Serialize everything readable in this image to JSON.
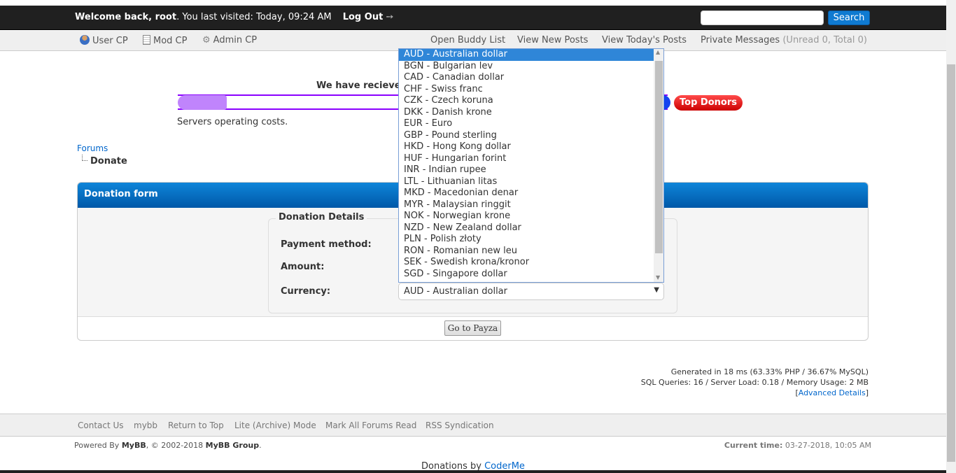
{
  "header": {
    "welcome_bold": "Welcome back, root",
    "welcome_rest": ". You last visited: Today, 09:24 AM",
    "logout": "Log Out",
    "logout_icon": "arrow-right-icon",
    "search_button": "Search",
    "search_value": ""
  },
  "menu": {
    "left": [
      {
        "label": "User CP",
        "icon": "user-icon"
      },
      {
        "label": "Mod CP",
        "icon": "notepad-icon"
      },
      {
        "label": "Admin CP",
        "icon": "gear-icon"
      }
    ],
    "right": {
      "buddy": "Open Buddy List",
      "new_posts": "View New Posts",
      "today": "View Today's Posts",
      "pm": "Private Messages",
      "pm_counts": "(Unread 0, Total 0)"
    }
  },
  "donation_goal": {
    "heading": "We have recieve",
    "progress_fraction": 0.1,
    "top_donors": "Top Donors",
    "description": "Servers operating costs."
  },
  "breadcrumb": {
    "root": "Forums",
    "current": "Donate"
  },
  "form": {
    "title": "Donation form",
    "legend": "Donation Details",
    "payment_label": "Payment method:",
    "amount_label": "Amount:",
    "currency_label": "Currency:",
    "currency_selected": "AUD - Australian dollar",
    "submit": "Go to Payza",
    "currency_options": [
      "AUD - Australian dollar",
      "BGN - Bulgarian lev",
      "CAD - Canadian dollar",
      "CHF - Swiss franc",
      "CZK - Czech koruna",
      "DKK - Danish krone",
      "EUR - Euro",
      "GBP - Pound sterling",
      "HKD - Hong Kong dollar",
      "HUF - Hungarian forint",
      "INR - Indian rupee",
      "LTL - Lithuanian litas",
      "MKD - Macedonian denar",
      "MYR - Malaysian ringgit",
      "NOK - Norwegian krone",
      "NZD - New Zealand dollar",
      "PLN - Polish złoty",
      "RON - Romanian new leu",
      "SEK - Swedish krona/kronor",
      "SGD - Singapore dollar"
    ]
  },
  "stats": {
    "line1": "Generated in 18 ms (63.33% PHP / 36.67% MySQL)",
    "line2": "SQL Queries: 16 / Server Load: 0.18 / Memory Usage: 2 MB",
    "advanced": "Advanced Details"
  },
  "footer": {
    "links": [
      "Contact Us",
      "mybb",
      "Return to Top",
      "Lite (Archive) Mode",
      "Mark All Forums Read",
      "RSS Syndication"
    ],
    "powered_prefix": "Powered By ",
    "powered_mybb": "MyBB",
    "powered_mid": ", © 2002-2018 ",
    "powered_group": "MyBB Group",
    "powered_end": ".",
    "time_label": "Current time:",
    "time_value": "03-27-2018, 10:05 AM",
    "donations_by": "Donations by ",
    "donations_author": "CoderMe"
  },
  "colors": {
    "accent": "#0f7ad1",
    "progress": "#c084fc",
    "progress_border": "#8a00ff",
    "top_donors": "#e01010"
  }
}
